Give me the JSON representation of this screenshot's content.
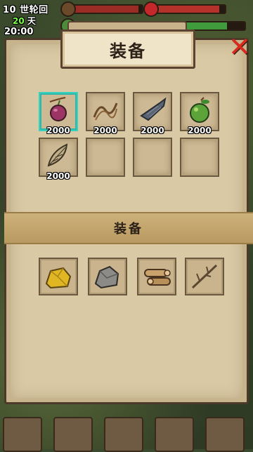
{
  "hud": {
    "cycle_text": "10 世轮回",
    "days_number": "20",
    "days_unit": "天",
    "time": "20:00",
    "hunger_level": 0.95,
    "health_level": 0.92,
    "energy_level": 0.9
  },
  "panel": {
    "title": "装备",
    "section_title": "装备",
    "inventory": [
      {
        "icon": "radish-icon",
        "count": "2000",
        "selected": true
      },
      {
        "icon": "rope-icon",
        "count": "2000",
        "selected": false
      },
      {
        "icon": "fish-icon",
        "count": "2000",
        "selected": false
      },
      {
        "icon": "fruit-icon",
        "count": "2000",
        "selected": false
      },
      {
        "icon": "leaf-bundle-icon",
        "count": "2000",
        "selected": false
      },
      {
        "icon": "empty",
        "count": "",
        "selected": false
      },
      {
        "icon": "empty",
        "count": "",
        "selected": false
      },
      {
        "icon": "empty",
        "count": "",
        "selected": false
      }
    ],
    "materials": [
      {
        "icon": "gold-ore-icon"
      },
      {
        "icon": "stone-icon"
      },
      {
        "icon": "wood-logs-icon"
      },
      {
        "icon": "branch-icon"
      }
    ]
  },
  "colors": {
    "selected_border": "#38d1c0",
    "close": "#d9291f",
    "panel_bg": "#d9c9a4"
  }
}
